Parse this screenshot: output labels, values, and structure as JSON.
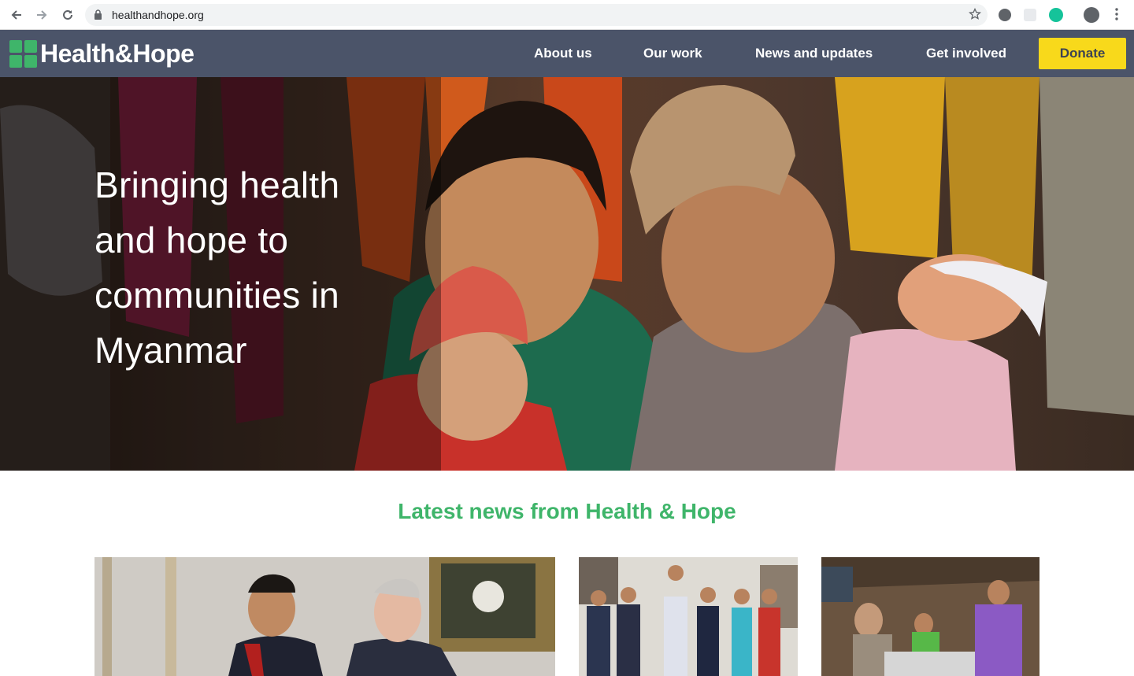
{
  "browser": {
    "url": "healthandhope.org",
    "icons": [
      "back-arrow-icon",
      "forward-arrow-icon",
      "reload-icon",
      "lock-icon",
      "star-icon",
      "extension-icon",
      "grammarly-icon",
      "profile-icon",
      "kebab-menu-icon"
    ]
  },
  "header": {
    "logo_text": "Health&Hope",
    "menu": [
      {
        "label": "About us"
      },
      {
        "label": "Our work"
      },
      {
        "label": "News and updates"
      },
      {
        "label": "Get involved"
      }
    ],
    "donate_label": "Donate",
    "colors": {
      "bar": "#4b5469",
      "brand_green": "#3fb56a",
      "donate_yellow": "#f8d91b"
    }
  },
  "hero": {
    "title_lines": [
      "Bringing health",
      "and hope to",
      "communities in",
      "Myanmar"
    ]
  },
  "news": {
    "heading": "Latest news from Health & Hope",
    "cards": [
      {
        "image": "two men in formal suits in a palace room"
      },
      {
        "image": "group of young people standing in a row"
      },
      {
        "image": "health workers at a table in a wooden clinic"
      }
    ]
  }
}
